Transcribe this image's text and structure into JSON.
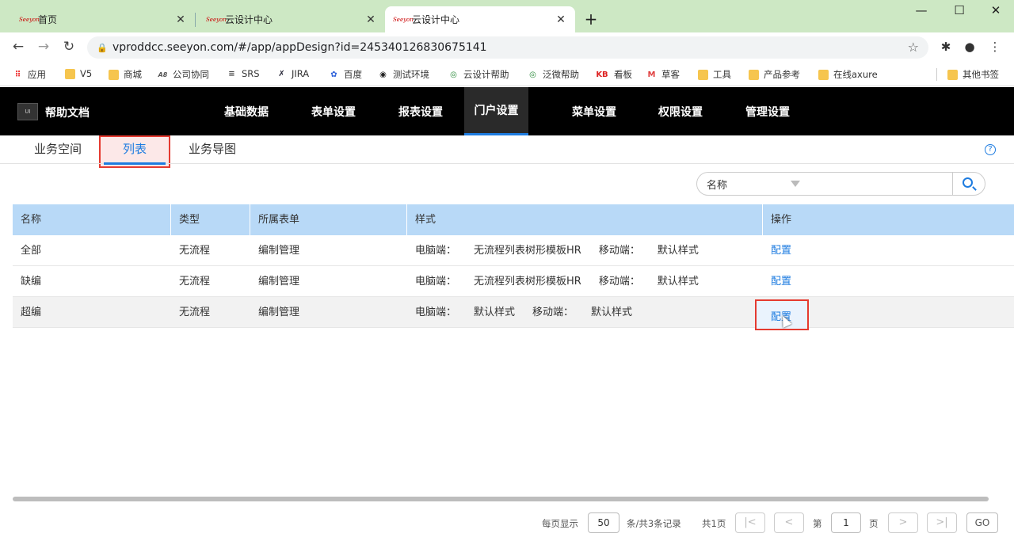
{
  "browser": {
    "tabs": [
      {
        "title": "首页",
        "favicon": "seeyon-logo-icon"
      },
      {
        "title": "云设计中心",
        "favicon": "seeyon-logo-icon"
      },
      {
        "title": "云设计中心",
        "favicon": "seeyon-logo-icon",
        "active": true
      }
    ],
    "favicon_text": "Seeyon",
    "close_glyph": "✕",
    "new_tab_glyph": "+",
    "window_controls": {
      "minimize": "—",
      "maximize": "☐",
      "close": "✕"
    },
    "nav": {
      "back": "←",
      "forward": "→",
      "reload": "↻"
    },
    "url": "vproddcc.seeyon.com/#/app/appDesign?id=245340126830675141",
    "lock_glyph": "🔒",
    "star_glyph": "☆",
    "ext_glyphs": {
      "puzzle": "✱",
      "profile": "●",
      "menu": "⋮"
    },
    "bookmarks": [
      {
        "label": "应用",
        "icon": "apps-grid-icon",
        "glyph": "⠿"
      },
      {
        "label": "V5",
        "icon": "folder-icon",
        "glyph": ""
      },
      {
        "label": "商城",
        "icon": "folder-icon",
        "glyph": ""
      },
      {
        "label": "公司协同",
        "icon": "a8-logo-icon",
        "glyph": "A8"
      },
      {
        "label": "SRS",
        "icon": "rdvs-logo-icon",
        "glyph": "≡"
      },
      {
        "label": "JIRA",
        "icon": "jira-logo-icon",
        "glyph": "✗"
      },
      {
        "label": "百度",
        "icon": "baidu-paw-icon",
        "glyph": "✿"
      },
      {
        "label": "测试环境",
        "icon": "globe-icon",
        "glyph": "◉"
      },
      {
        "label": "云设计帮助",
        "icon": "help-logo-icon",
        "glyph": "◎"
      },
      {
        "label": "泛微帮助",
        "icon": "help-logo-icon",
        "glyph": "◎"
      },
      {
        "label": "看板",
        "icon": "kb-logo-icon",
        "glyph": "KB"
      },
      {
        "label": "草客",
        "icon": "mail-icon",
        "glyph": "M"
      },
      {
        "label": "工具",
        "icon": "folder-icon",
        "glyph": ""
      },
      {
        "label": "产品参考",
        "icon": "folder-icon",
        "glyph": ""
      },
      {
        "label": "在线axure",
        "icon": "folder-icon",
        "glyph": ""
      }
    ],
    "other_bookmarks": "其他书签"
  },
  "app": {
    "logo_text": "UI",
    "name": "帮助文档",
    "nav": [
      "基础数据",
      "表单设置",
      "报表设置",
      "门户设置",
      "菜单设置",
      "权限设置",
      "管理设置"
    ],
    "active_nav": "门户设置"
  },
  "subtabs": [
    "业务空间",
    "列表",
    "业务导图"
  ],
  "active_subtab": "列表",
  "help_glyph": "?",
  "search": {
    "field_selected": "名称",
    "placeholder": ""
  },
  "table": {
    "headers": [
      "名称",
      "类型",
      "所属表单",
      "样式",
      "操作"
    ],
    "style_labels": {
      "pc": "电脑端：",
      "mobile": "移动端："
    },
    "rows": [
      {
        "name": "全部",
        "type": "无流程",
        "form": "编制管理",
        "pc_style": "无流程列表树形模板HR",
        "mobile_style": "默认样式",
        "action": "配置"
      },
      {
        "name": "缺编",
        "type": "无流程",
        "form": "编制管理",
        "pc_style": "无流程列表树形模板HR",
        "mobile_style": "默认样式",
        "action": "配置"
      },
      {
        "name": "超编",
        "type": "无流程",
        "form": "编制管理",
        "pc_style": "默认样式",
        "mobile_style": "默认样式",
        "action": "配置"
      }
    ]
  },
  "pagination": {
    "per_page_label": "每页显示",
    "per_page": "50",
    "total_label": "条/共3条记录",
    "pages_label": "共1页",
    "page_prefix": "第",
    "current_page": "1",
    "page_suffix": "页",
    "go": "GO",
    "first": "|<",
    "prev": "<",
    "next": ">",
    "last": ">|"
  },
  "colors": {
    "accent": "#1e7ce0",
    "highlight_border": "#e53a30",
    "header_bg": "#b8d9f7",
    "nav_bg": "#000000",
    "tabstrip_bg": "#cde8c4"
  }
}
